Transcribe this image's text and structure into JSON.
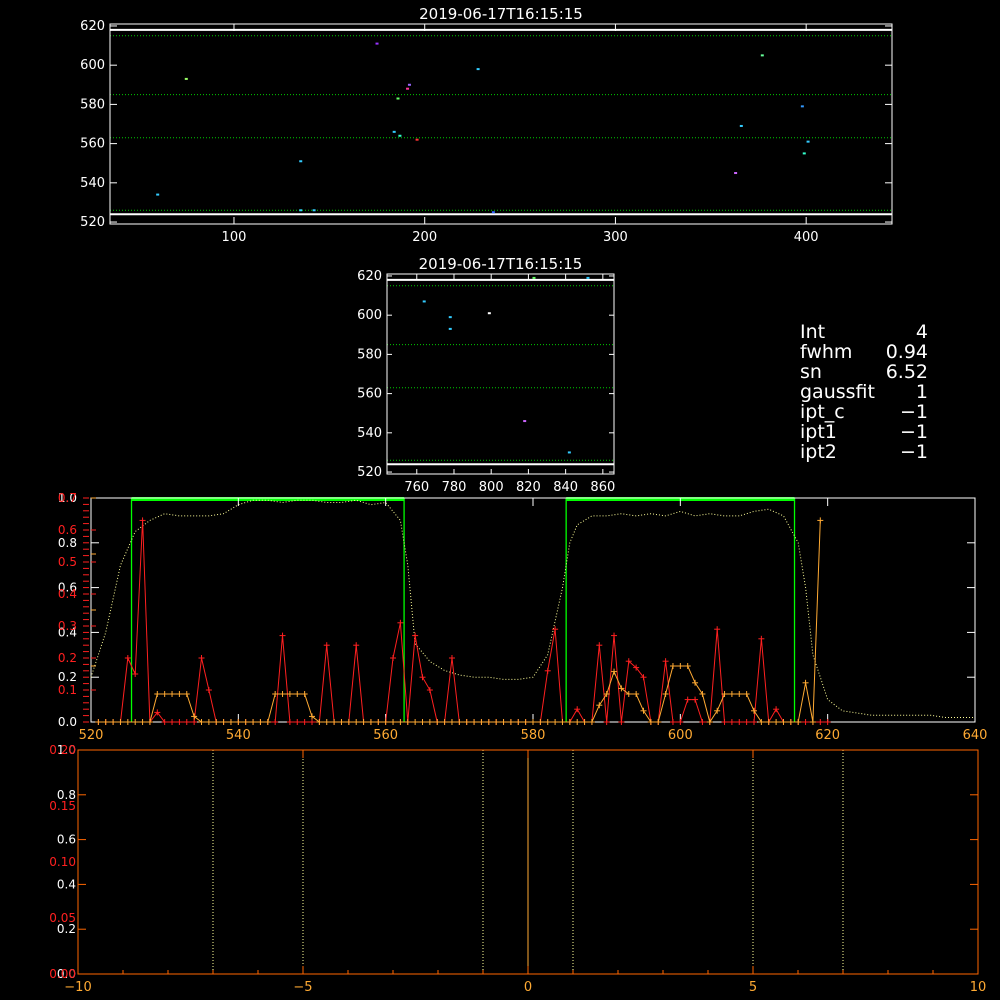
{
  "info_panel": {
    "rows": [
      {
        "key": "Int",
        "value": "4"
      },
      {
        "key": "fwhm",
        "value": "0.94"
      },
      {
        "key": "sn",
        "value": "6.52"
      },
      {
        "key": "gaussfit",
        "value": "1"
      },
      {
        "key": "ipt_c",
        "value": "−1"
      },
      {
        "key": "ipt1",
        "value": "−1"
      },
      {
        "key": "ipt2",
        "value": "−1"
      }
    ]
  },
  "colors": {
    "background": "#000000",
    "axis": "#ffffff",
    "guide": "#00cc00",
    "red": "#ff2020",
    "orange": "#ffaa33",
    "yellow_dotted": "#ffff99",
    "green_box": "#00ff00",
    "bottom_axis": "#ff6600"
  },
  "chart_data": [
    {
      "type": "scatter",
      "title": "2019-06-17T16:15:15",
      "xlim": [
        35,
        445
      ],
      "ylim": [
        519,
        621
      ],
      "xticks": [
        100,
        200,
        300,
        400
      ],
      "yticks": [
        520,
        540,
        560,
        580,
        600,
        620
      ],
      "hlines": [
        {
          "y": 618,
          "style": "solid",
          "color": "#ffffff"
        },
        {
          "y": 615,
          "style": "dotted",
          "color": "#00cc00"
        },
        {
          "y": 585,
          "style": "dotted",
          "color": "#00cc00"
        },
        {
          "y": 563,
          "style": "dotted",
          "color": "#00cc00"
        },
        {
          "y": 526,
          "style": "dotted",
          "color": "#00cc00"
        },
        {
          "y": 524,
          "style": "solid",
          "color": "#ffffff"
        }
      ],
      "points": [
        {
          "x": 60,
          "y": 534,
          "color": "#33ccff"
        },
        {
          "x": 75,
          "y": 593,
          "color": "#99ff66"
        },
        {
          "x": 135,
          "y": 551,
          "color": "#33ccff"
        },
        {
          "x": 135,
          "y": 526,
          "color": "#33ccff"
        },
        {
          "x": 142,
          "y": 526,
          "color": "#33ccff"
        },
        {
          "x": 175,
          "y": 611,
          "color": "#9933ff"
        },
        {
          "x": 184,
          "y": 566,
          "color": "#33ccff"
        },
        {
          "x": 186,
          "y": 583,
          "color": "#66ff66"
        },
        {
          "x": 187,
          "y": 564,
          "color": "#33ffcc"
        },
        {
          "x": 191,
          "y": 588,
          "color": "#ff3399"
        },
        {
          "x": 192,
          "y": 590,
          "color": "#9966ff"
        },
        {
          "x": 196,
          "y": 562,
          "color": "#ff3333"
        },
        {
          "x": 228,
          "y": 598,
          "color": "#33ccff"
        },
        {
          "x": 236,
          "y": 525,
          "color": "#3366ff"
        },
        {
          "x": 363,
          "y": 545,
          "color": "#cc66ff"
        },
        {
          "x": 366,
          "y": 569,
          "color": "#33ccff"
        },
        {
          "x": 377,
          "y": 605,
          "color": "#66ff99"
        },
        {
          "x": 398,
          "y": 579,
          "color": "#3399ff"
        },
        {
          "x": 399,
          "y": 555,
          "color": "#33ffcc"
        },
        {
          "x": 401,
          "y": 561,
          "color": "#33ccff"
        }
      ]
    },
    {
      "type": "scatter",
      "title": "2019-06-17T16:15:15",
      "xlim": [
        744,
        866
      ],
      "ylim": [
        519,
        621
      ],
      "xticks": [
        760,
        780,
        800,
        820,
        840,
        860
      ],
      "yticks": [
        520,
        540,
        560,
        580,
        600,
        620
      ],
      "hlines": [
        {
          "y": 618,
          "style": "solid",
          "color": "#ffffff"
        },
        {
          "y": 615,
          "style": "dotted",
          "color": "#00cc00"
        },
        {
          "y": 585,
          "style": "dotted",
          "color": "#00cc00"
        },
        {
          "y": 563,
          "style": "dotted",
          "color": "#00cc00"
        },
        {
          "y": 526,
          "style": "dotted",
          "color": "#00cc00"
        },
        {
          "y": 524,
          "style": "solid",
          "color": "#ffffff"
        }
      ],
      "points": [
        {
          "x": 764,
          "y": 607,
          "color": "#33ccff"
        },
        {
          "x": 778,
          "y": 599,
          "color": "#33ccff"
        },
        {
          "x": 778,
          "y": 593,
          "color": "#33ccff"
        },
        {
          "x": 799,
          "y": 601,
          "color": "#ffffff"
        },
        {
          "x": 818,
          "y": 546,
          "color": "#cc66ff"
        },
        {
          "x": 823,
          "y": 619,
          "color": "#66ff66"
        },
        {
          "x": 842,
          "y": 530,
          "color": "#33ccff"
        },
        {
          "x": 852,
          "y": 619,
          "color": "#33ccff"
        }
      ]
    },
    {
      "type": "line",
      "xlim": [
        520,
        640
      ],
      "xticks": [
        520,
        540,
        560,
        580,
        600,
        620,
        640
      ],
      "yticks_white": [
        "0.0",
        "0.2",
        "0.4",
        "0.6",
        "0.8",
        "1.0"
      ],
      "yticks_red": [
        "0.1",
        "0.2",
        "0.3",
        "0.4",
        "0.5",
        "0.6",
        "0.7"
      ],
      "yticks_orange": [
        "0.1",
        "0.2",
        "0.3",
        "0.4"
      ],
      "boxes": [
        {
          "x0": 525.5,
          "x1": 562.5
        },
        {
          "x0": 584.5,
          "x1": 615.5
        }
      ],
      "series": [
        {
          "color": "#ffff99",
          "style": "dotted",
          "ylim": [
            0,
            1.0
          ],
          "x": [
            520,
            522,
            524,
            526,
            528,
            530,
            532,
            534,
            536,
            538,
            540,
            542,
            544,
            546,
            548,
            550,
            552,
            554,
            556,
            558,
            560,
            562,
            563,
            564,
            566,
            568,
            570,
            572,
            574,
            576,
            578,
            580,
            582,
            583,
            584,
            585,
            586,
            588,
            590,
            592,
            594,
            596,
            598,
            600,
            602,
            604,
            606,
            608,
            610,
            612,
            614,
            616,
            617,
            618,
            620,
            622,
            624,
            626,
            628,
            630,
            632,
            634,
            636,
            638,
            640
          ],
          "y": [
            0.2,
            0.4,
            0.7,
            0.85,
            0.9,
            0.93,
            0.92,
            0.92,
            0.92,
            0.93,
            0.97,
            0.99,
            0.99,
            0.98,
            0.99,
            0.99,
            0.98,
            0.98,
            0.99,
            0.97,
            0.98,
            0.9,
            0.7,
            0.35,
            0.27,
            0.23,
            0.21,
            0.2,
            0.2,
            0.19,
            0.19,
            0.2,
            0.3,
            0.45,
            0.6,
            0.8,
            0.88,
            0.92,
            0.92,
            0.93,
            0.92,
            0.93,
            0.92,
            0.94,
            0.92,
            0.93,
            0.92,
            0.92,
            0.94,
            0.95,
            0.92,
            0.8,
            0.6,
            0.3,
            0.1,
            0.05,
            0.04,
            0.03,
            0.03,
            0.03,
            0.03,
            0.03,
            0.02,
            0.02,
            0.02
          ]
        },
        {
          "color": "#ff2020",
          "style": "line+plus",
          "ylim": [
            0,
            0.7
          ],
          "x": [
            521,
            522,
            523,
            524,
            525,
            526,
            527,
            528,
            529,
            530,
            531,
            532,
            533,
            534,
            535,
            536,
            537,
            538,
            539,
            540,
            541,
            542,
            543,
            544,
            545,
            546,
            547,
            548,
            549,
            550,
            551,
            552,
            553,
            554,
            555,
            556,
            557,
            558,
            559,
            560,
            561,
            562,
            563,
            564,
            565,
            566,
            567,
            568,
            569,
            570,
            571,
            572,
            573,
            574,
            575,
            576,
            577,
            578,
            579,
            580,
            581,
            582,
            583,
            584,
            585,
            586,
            587,
            588,
            589,
            590,
            591,
            592,
            593,
            594,
            595,
            596,
            597,
            598,
            599,
            600,
            601,
            602,
            603,
            604,
            605,
            606,
            607,
            608,
            609,
            610,
            611,
            612,
            613,
            614,
            615,
            616,
            617,
            618,
            619,
            620
          ],
          "y": [
            0.0,
            0.0,
            0.0,
            0.0,
            0.2,
            0.15,
            0.63,
            0.0,
            0.03,
            0.0,
            0.0,
            0.0,
            0.0,
            0.0,
            0.2,
            0.1,
            0.0,
            0.0,
            0.0,
            0.0,
            0.0,
            0.0,
            0.0,
            0.0,
            0.0,
            0.27,
            0.0,
            0.0,
            0.0,
            0.0,
            0.0,
            0.24,
            0.0,
            0.0,
            0.0,
            0.24,
            0.0,
            0.0,
            0.0,
            0.0,
            0.2,
            0.31,
            0.0,
            0.27,
            0.14,
            0.1,
            0.0,
            0.0,
            0.2,
            0.0,
            0.0,
            0.0,
            0.0,
            0.0,
            0.0,
            0.0,
            0.0,
            0.0,
            0.0,
            0.0,
            0.0,
            0.16,
            0.29,
            0.0,
            0.0,
            0.04,
            0.0,
            0.0,
            0.24,
            0.0,
            0.27,
            0.0,
            0.19,
            0.17,
            0.14,
            0.0,
            0.0,
            0.19,
            0.0,
            0.0,
            0.07,
            0.07,
            0.0,
            0.0,
            0.29,
            0.0,
            0.0,
            0.0,
            0.0,
            0.0,
            0.26,
            0.0,
            0.04,
            0.0,
            0.0,
            0.0,
            0.0,
            0.0,
            0.0,
            0.0
          ]
        },
        {
          "color": "#ffaa33",
          "style": "line+plus",
          "ylim": [
            0,
            0.4
          ],
          "x": [
            521,
            522,
            523,
            524,
            525,
            526,
            527,
            528,
            529,
            530,
            531,
            532,
            533,
            534,
            535,
            536,
            537,
            538,
            539,
            540,
            541,
            542,
            543,
            544,
            545,
            546,
            547,
            548,
            549,
            550,
            551,
            552,
            553,
            554,
            555,
            556,
            557,
            558,
            559,
            560,
            561,
            562,
            563,
            564,
            565,
            566,
            567,
            568,
            569,
            570,
            571,
            572,
            573,
            574,
            575,
            576,
            577,
            578,
            579,
            580,
            581,
            582,
            583,
            584,
            585,
            586,
            587,
            588,
            589,
            590,
            591,
            592,
            593,
            594,
            595,
            596,
            597,
            598,
            599,
            600,
            601,
            602,
            603,
            604,
            605,
            606,
            607,
            608,
            609,
            610,
            611,
            612,
            613,
            614,
            615,
            616,
            617,
            618,
            619
          ],
          "y": [
            0.0,
            0.0,
            0.0,
            0.0,
            0.0,
            0.0,
            0.0,
            0.0,
            0.05,
            0.05,
            0.05,
            0.05,
            0.05,
            0.01,
            0.0,
            0.0,
            0.0,
            0.0,
            0.0,
            0.0,
            0.0,
            0.0,
            0.0,
            0.0,
            0.05,
            0.05,
            0.05,
            0.05,
            0.05,
            0.01,
            0.0,
            0.0,
            0.0,
            0.0,
            0.0,
            0.0,
            0.0,
            0.0,
            0.0,
            0.0,
            0.0,
            0.0,
            0.0,
            0.0,
            0.0,
            0.0,
            0.0,
            0.0,
            0.0,
            0.0,
            0.0,
            0.0,
            0.0,
            0.0,
            0.0,
            0.0,
            0.0,
            0.0,
            0.0,
            0.0,
            0.0,
            0.0,
            0.0,
            0.0,
            0.0,
            0.0,
            0.0,
            0.0,
            0.03,
            0.05,
            0.09,
            0.06,
            0.05,
            0.05,
            0.02,
            0.0,
            0.0,
            0.05,
            0.1,
            0.1,
            0.1,
            0.07,
            0.05,
            0.0,
            0.02,
            0.05,
            0.05,
            0.05,
            0.05,
            0.02,
            0.0,
            0.0,
            0.0,
            0.0,
            0.0,
            0.0,
            0.07,
            0.0,
            0.36
          ]
        }
      ]
    },
    {
      "type": "line",
      "xlim": [
        -10,
        10
      ],
      "xticks": [
        -10,
        -5,
        0,
        5,
        10
      ],
      "yticks_white": [
        "0.0",
        "0.2",
        "0.4",
        "0.6",
        "0.8",
        "1.0"
      ],
      "yticks_red": [
        "0.00",
        "0.05",
        "0.10",
        "0.15",
        "0.20"
      ],
      "vlines": [
        {
          "x": -7,
          "style": "dotted",
          "color": "#ffff99"
        },
        {
          "x": -5,
          "style": "dotted",
          "color": "#ffff99"
        },
        {
          "x": -1,
          "style": "dotted",
          "color": "#ffff99"
        },
        {
          "x": 0,
          "style": "solid",
          "color": "#ffaa33"
        },
        {
          "x": 1,
          "style": "dotted",
          "color": "#ffff99"
        },
        {
          "x": 5,
          "style": "dotted",
          "color": "#ffff99"
        },
        {
          "x": 7,
          "style": "dotted",
          "color": "#ffff99"
        }
      ]
    }
  ]
}
